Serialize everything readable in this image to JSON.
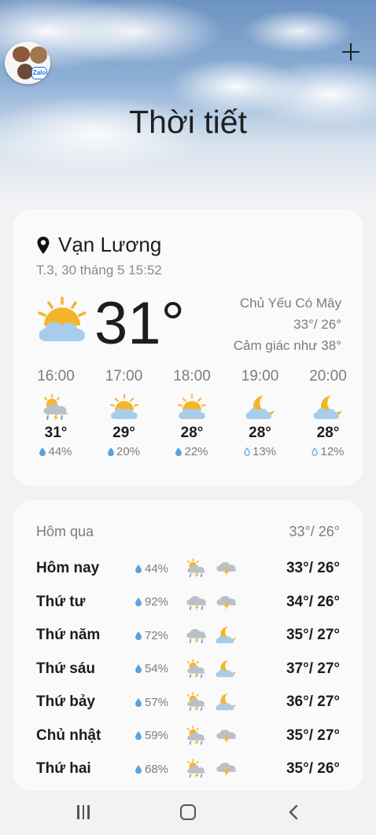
{
  "header": {
    "title": "Thời tiết",
    "add_label": "+",
    "avatar_badge": "Zalo"
  },
  "current": {
    "location": "Vạn Lương",
    "datetime": "T.3, 30 tháng 5 15:52",
    "temperature": "31°",
    "condition": "Chủ Yếu Có Mây",
    "high_low": "33°/ 26°",
    "feels_like": "Cảm giác như 38°",
    "icon": "partly-cloudy-icon"
  },
  "hourly": [
    {
      "time": "16:00",
      "temp": "31°",
      "humidity": "44%",
      "icon": "sun-cloud-rain-thunder-icon"
    },
    {
      "time": "17:00",
      "temp": "29°",
      "humidity": "20%",
      "icon": "partly-cloudy-icon"
    },
    {
      "time": "18:00",
      "temp": "28°",
      "humidity": "22%",
      "icon": "partly-cloudy-icon"
    },
    {
      "time": "19:00",
      "temp": "28°",
      "humidity": "13%",
      "icon": "moon-cloud-icon"
    },
    {
      "time": "20:00",
      "temp": "28°",
      "humidity": "12%",
      "icon": "moon-cloud-icon"
    }
  ],
  "yesterday": {
    "label": "Hôm qua",
    "temps": "33°/ 26°"
  },
  "daily": [
    {
      "day": "Hôm nay",
      "humidity": "44%",
      "temps": "33°/ 26°",
      "day_icon": "sun-cloud-rain-thunder-icon",
      "night_icon": "cloud-thunder-icon"
    },
    {
      "day": "Thứ tư",
      "humidity": "92%",
      "temps": "34°/ 26°",
      "day_icon": "cloud-rain-thunder-icon",
      "night_icon": "cloud-thunder-icon"
    },
    {
      "day": "Thứ năm",
      "humidity": "72%",
      "temps": "35°/ 27°",
      "day_icon": "cloud-rain-thunder-icon",
      "night_icon": "moon-cloud-icon"
    },
    {
      "day": "Thứ sáu",
      "humidity": "54%",
      "temps": "37°/ 27°",
      "day_icon": "sun-cloud-rain-thunder-icon",
      "night_icon": "moon-cloud-icon"
    },
    {
      "day": "Thứ bảy",
      "humidity": "57%",
      "temps": "36°/ 27°",
      "day_icon": "sun-cloud-rain-thunder-icon",
      "night_icon": "moon-cloud-icon"
    },
    {
      "day": "Chủ nhật",
      "humidity": "59%",
      "temps": "35°/ 27°",
      "day_icon": "sun-cloud-rain-thunder-icon",
      "night_icon": "cloud-thunder-icon"
    },
    {
      "day": "Thứ hai",
      "humidity": "68%",
      "temps": "35°/ 26°",
      "day_icon": "sun-cloud-rain-thunder-icon",
      "night_icon": "cloud-thunder-icon"
    }
  ],
  "colors": {
    "sun": "#f5b52a",
    "cloud": "#a8cdeb",
    "grey_cloud": "#b9c0c8",
    "moon": "#f5b52a",
    "drop": "#5aa3de",
    "bolt": "#f5b52a"
  },
  "navbar": {
    "recent_icon": "recent-apps-icon",
    "home_icon": "home-icon",
    "back_icon": "back-icon"
  }
}
